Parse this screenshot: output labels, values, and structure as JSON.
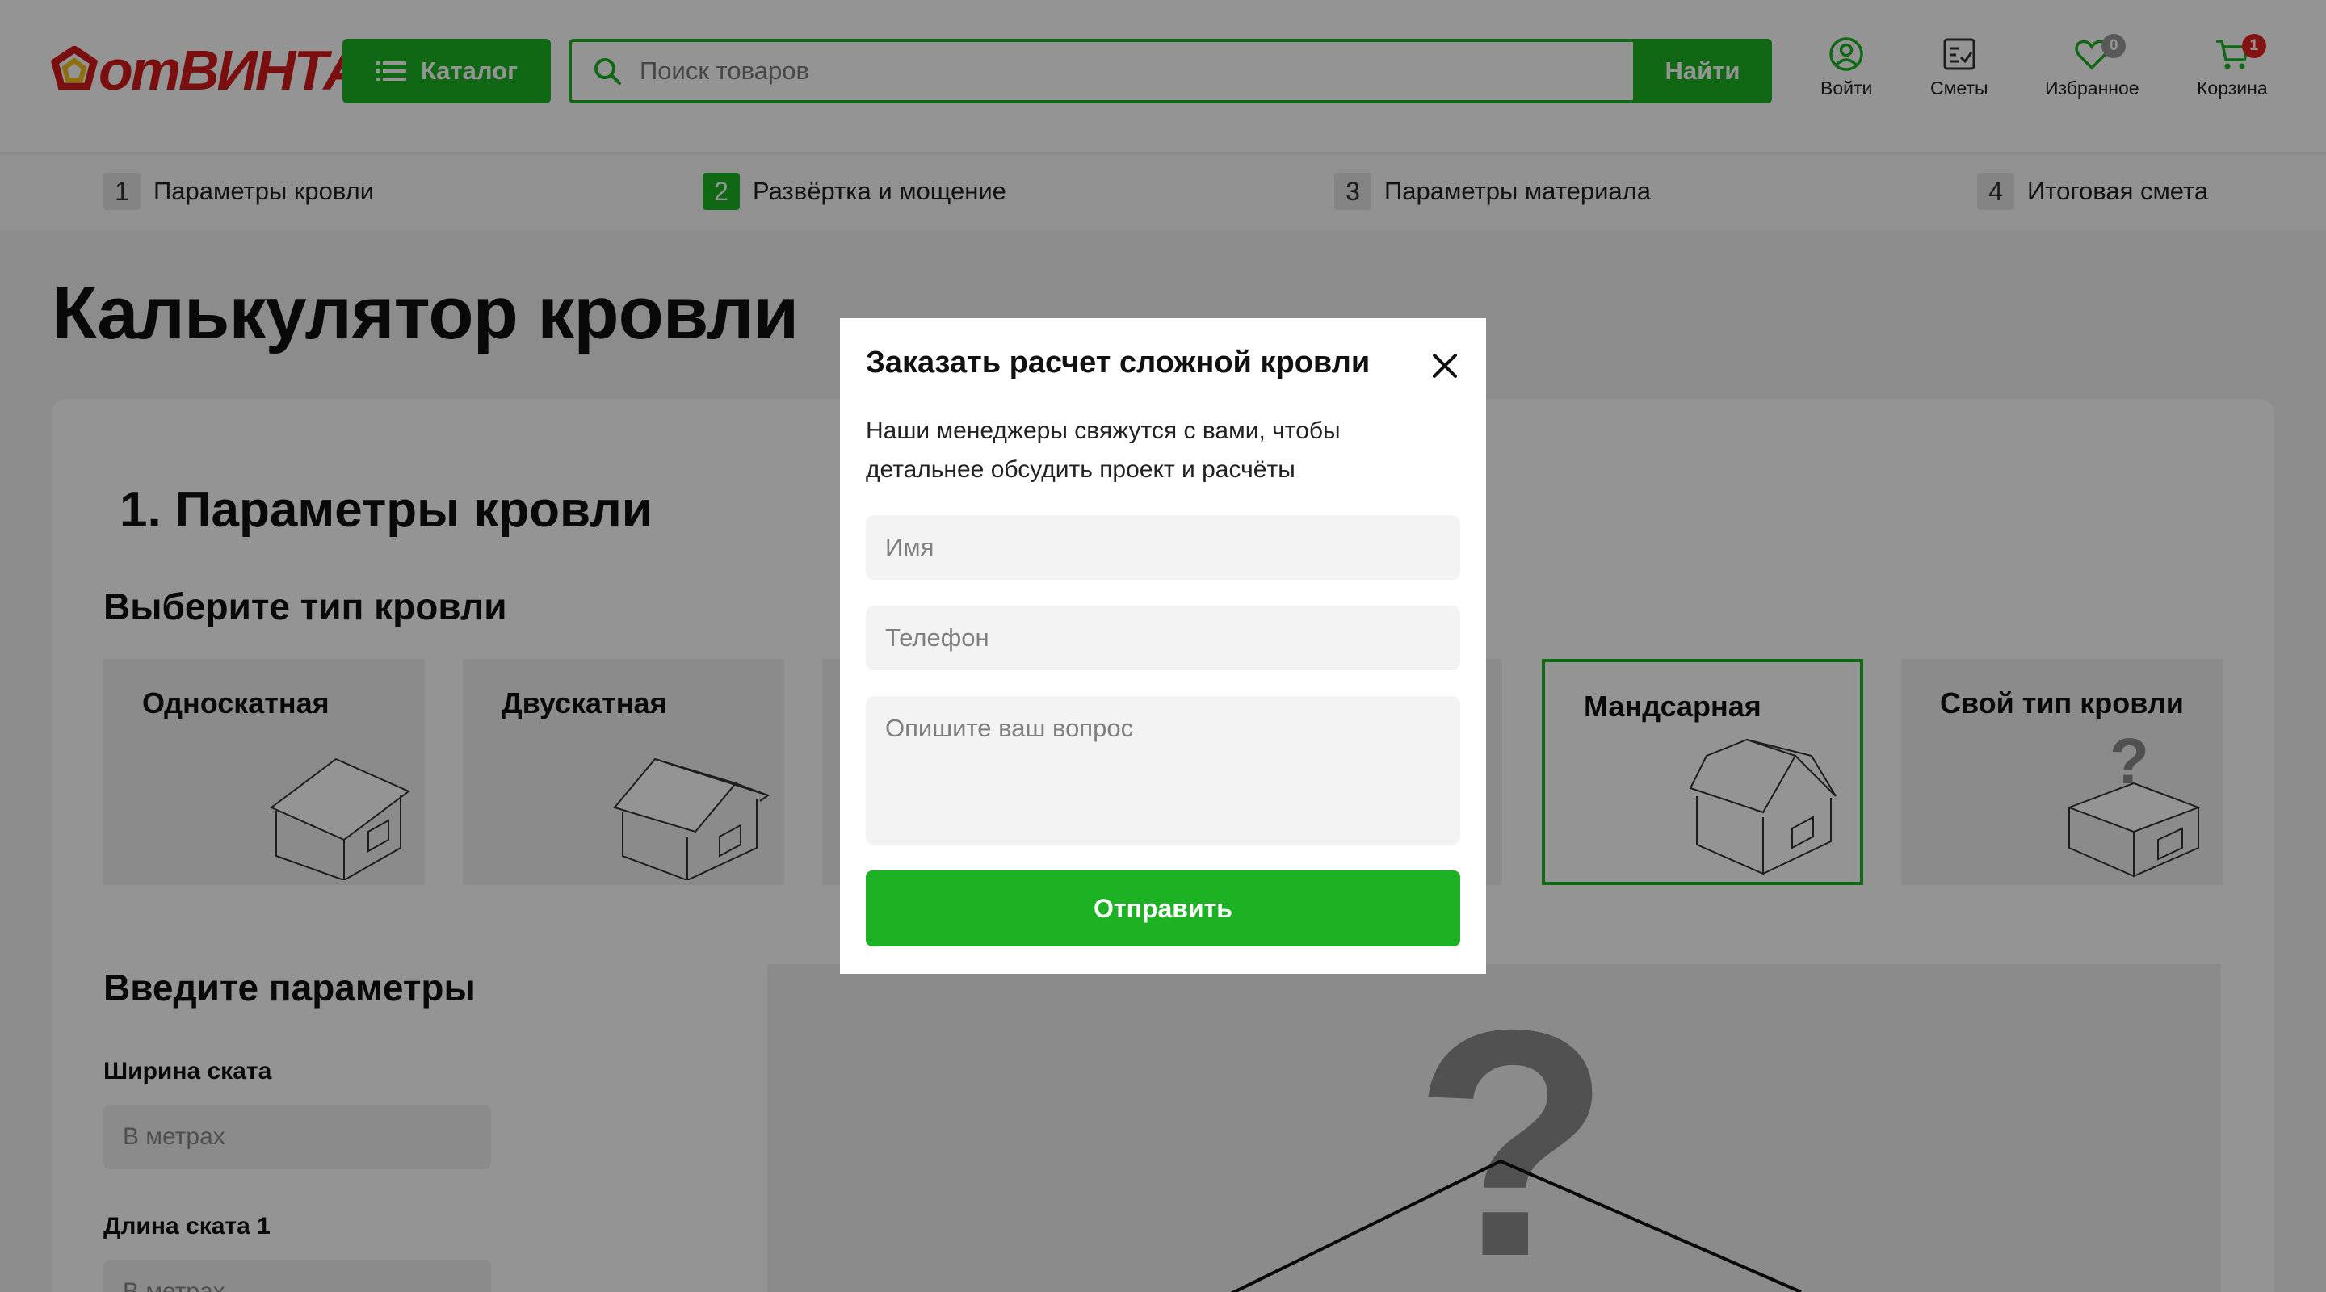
{
  "header": {
    "logo_prefix": "от",
    "logo_main": "ВИНТА",
    "logo_suffix": "!",
    "catalog_label": "Каталог",
    "search_placeholder": "Поиск товаров",
    "search_button": "Найти",
    "actions": {
      "login": "Войти",
      "estimates": "Сметы",
      "favorites": "Избранное",
      "favorites_count": "0",
      "cart": "Корзина",
      "cart_count": "1"
    }
  },
  "stepper": [
    {
      "num": "1",
      "label": "Параметры кровли"
    },
    {
      "num": "2",
      "label": "Развёртка и мощение"
    },
    {
      "num": "3",
      "label": "Параметры материала"
    },
    {
      "num": "4",
      "label": "Итоговая смета"
    }
  ],
  "page": {
    "title": "Калькулятор кровли",
    "section_title": "1. Параметры кровли",
    "roof_type_title": "Выберите тип кровли",
    "roof_types": [
      "Односкатная",
      "Двускатная",
      "Мандсарная",
      "Свой тип кровли"
    ],
    "params_title": "Введите параметры",
    "fields": [
      {
        "label": "Ширина ската",
        "placeholder": "В метрах"
      },
      {
        "label": "Длина ската 1",
        "placeholder": "В метрах"
      }
    ]
  },
  "modal": {
    "title": "Заказать расчет сложной кровли",
    "description": "Наши менеджеры свяжутся с вами, чтобы детальнее обсудить проект и расчёты",
    "name_placeholder": "Имя",
    "phone_placeholder": "Телефон",
    "question_placeholder": "Опишите ваш вопрос",
    "submit_label": "Отправить"
  },
  "colors": {
    "brand_green": "#1db224",
    "logo_red": "#d21b1b",
    "logo_yellow": "#f4c018",
    "badge_grey": "#9a9a9a",
    "badge_red": "#e02424"
  }
}
